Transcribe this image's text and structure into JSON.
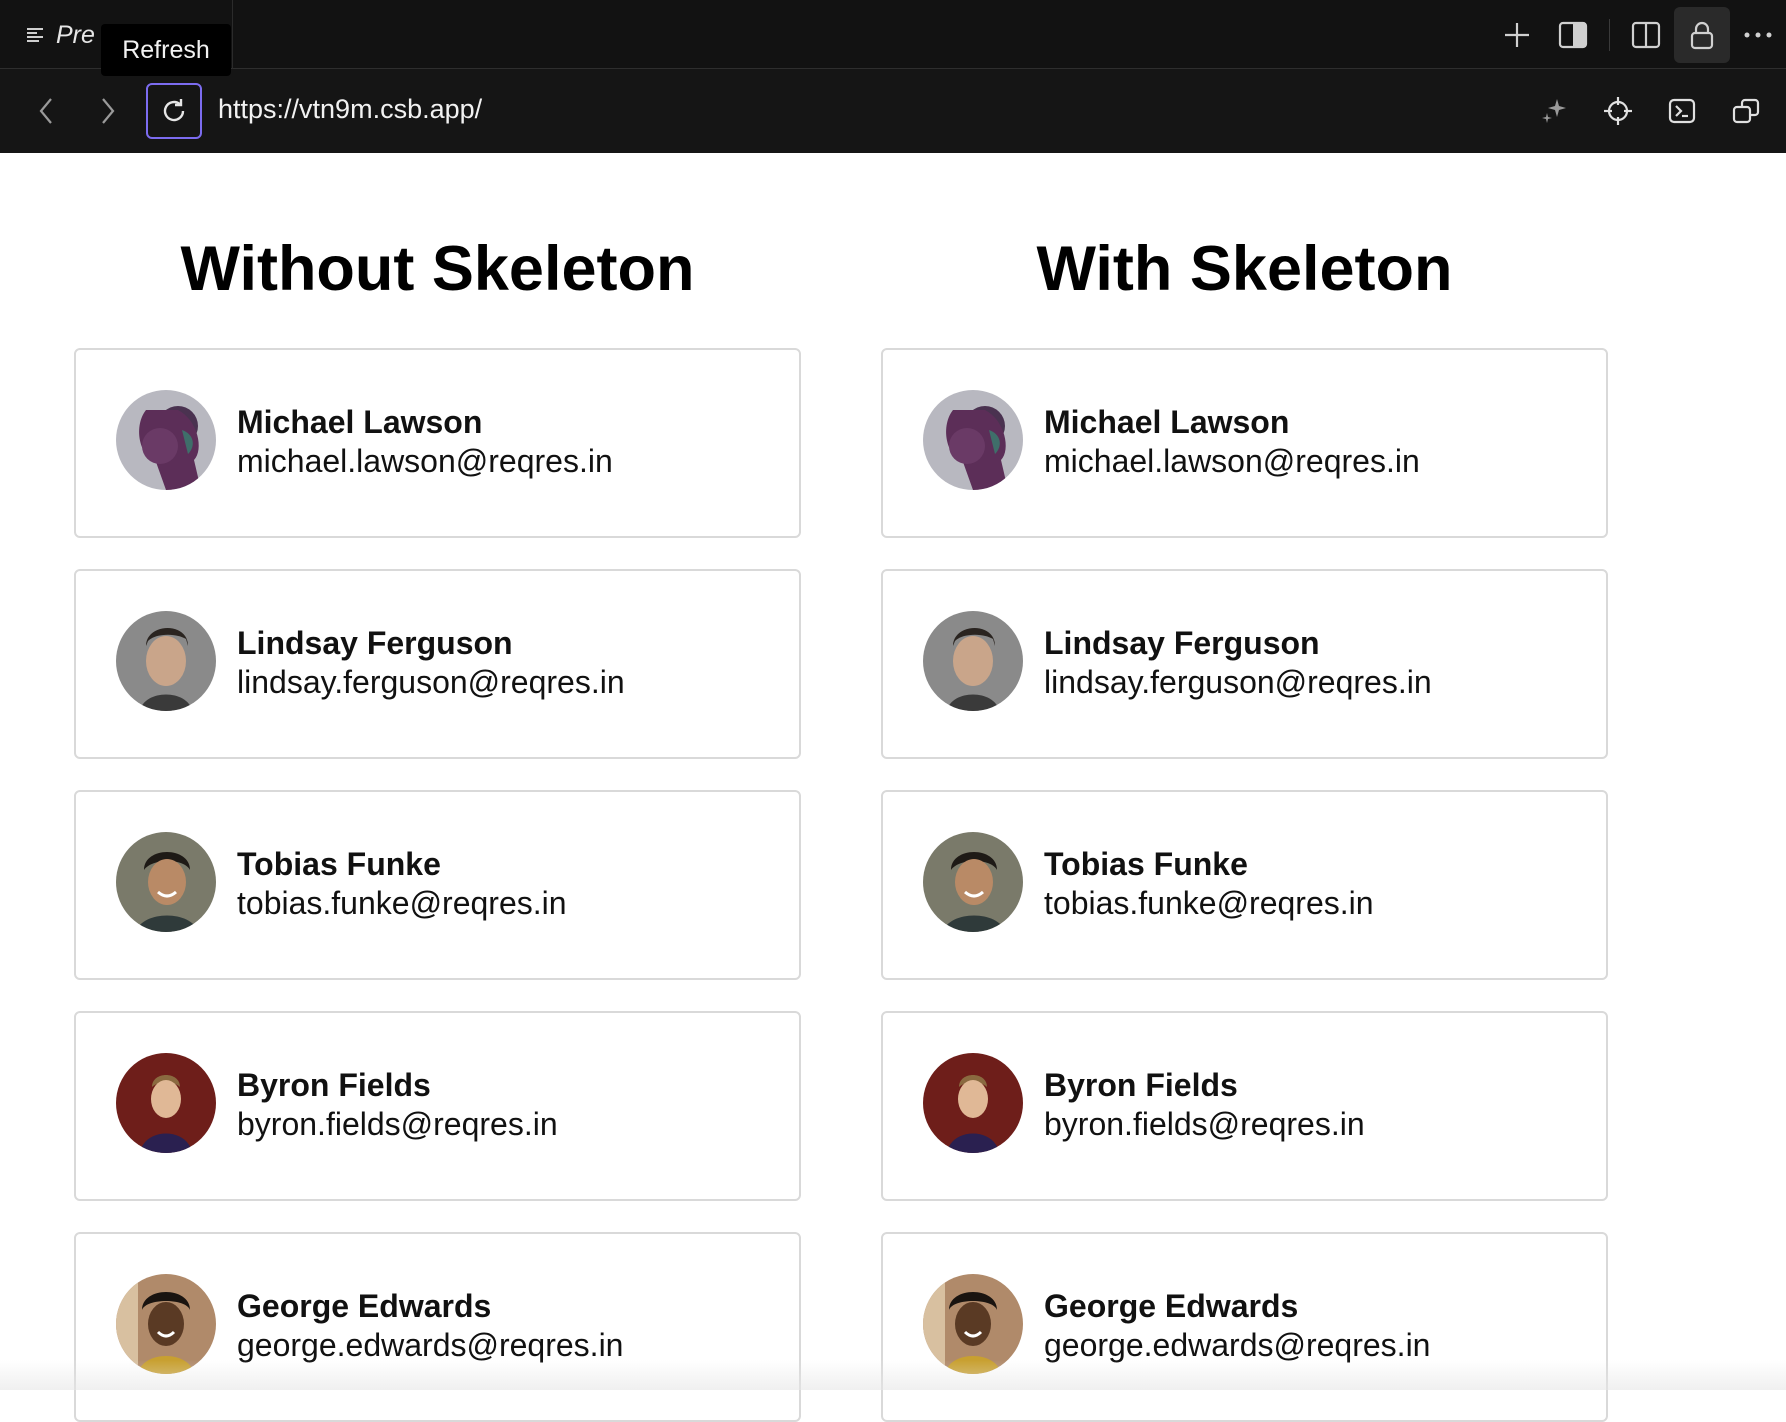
{
  "browser": {
    "tab_label": "Pre",
    "tooltip": "Refresh",
    "url": "https://vtn9m.csb.app/",
    "accent": "#7c6cf0",
    "toolbar_icons": [
      "plus-icon",
      "sidebar-panel-icon",
      "split-view-icon",
      "lock-icon",
      "more-icon"
    ],
    "nav_icons": [
      "back-icon",
      "forward-icon",
      "refresh-icon"
    ],
    "nav_right_icons": [
      "sparkle-icon",
      "crosshair-icon",
      "terminal-icon",
      "new-window-icon"
    ]
  },
  "left_column": {
    "title": "Without Skeleton",
    "users": [
      {
        "name": "Michael Lawson",
        "email": "michael.lawson@reqres.in"
      },
      {
        "name": "Lindsay Ferguson",
        "email": "lindsay.ferguson@reqres.in"
      },
      {
        "name": "Tobias Funke",
        "email": "tobias.funke@reqres.in"
      },
      {
        "name": "Byron Fields",
        "email": "byron.fields@reqres.in"
      },
      {
        "name": "George Edwards",
        "email": "george.edwards@reqres.in"
      }
    ]
  },
  "right_column": {
    "title": "With Skeleton",
    "users": [
      {
        "name": "Michael Lawson",
        "email": "michael.lawson@reqres.in"
      },
      {
        "name": "Lindsay Ferguson",
        "email": "lindsay.ferguson@reqres.in"
      },
      {
        "name": "Tobias Funke",
        "email": "tobias.funke@reqres.in"
      },
      {
        "name": "Byron Fields",
        "email": "byron.fields@reqres.in"
      },
      {
        "name": "George Edwards",
        "email": "george.edwards@reqres.in"
      }
    ]
  }
}
